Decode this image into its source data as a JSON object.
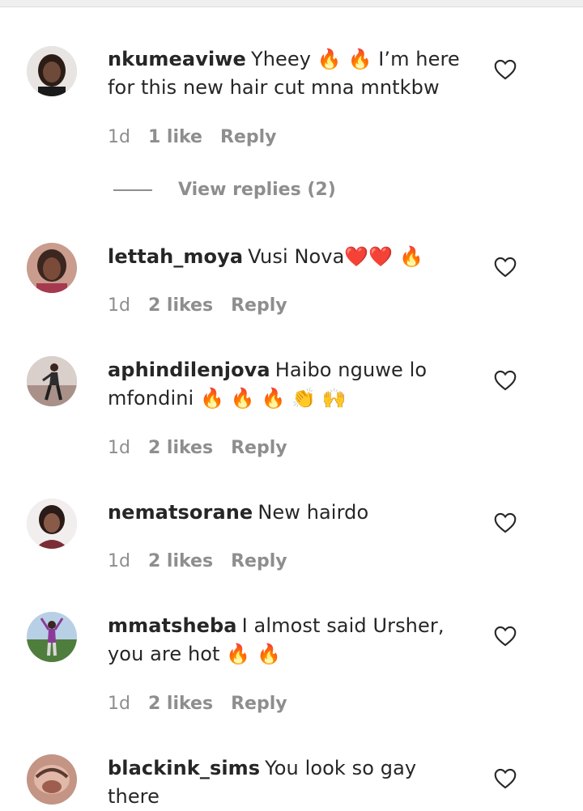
{
  "comments": [
    {
      "username": "nkumeaviwe",
      "text": "Yheey 🔥 🔥 I’m here for this new hair cut mna mntkbw",
      "time": "1d",
      "likes": "1 like",
      "reply": "Reply",
      "avatar_color": "#3a2a22"
    },
    {
      "username": "lettah_moya",
      "text": "Vusi Nova❤️❤️ 🔥",
      "time": "1d",
      "likes": "2 likes",
      "reply": "Reply",
      "avatar_color": "#b98d7c"
    },
    {
      "username": "aphindilenjova",
      "text": "Haibo nguwe lo mfondini 🔥 🔥 🔥 👏 🙌",
      "time": "1d",
      "likes": "2 likes",
      "reply": "Reply",
      "avatar_color": "#b9a9a4"
    },
    {
      "username": "nematsorane",
      "text": "New hairdo",
      "time": "1d",
      "likes": "2 likes",
      "reply": "Reply",
      "avatar_color": "#7a3b3b"
    },
    {
      "username": "mmatsheba",
      "text": "I almost said Ursher, you are hot 🔥 🔥",
      "time": "1d",
      "likes": "2 likes",
      "reply": "Reply",
      "avatar_color": "#6e8f5c"
    },
    {
      "username": "blackink_sims",
      "text": "You look so gay there",
      "avatar_color": "#b57b6a"
    }
  ],
  "view_replies": "View replies (2)",
  "icons": {
    "heart": "heart-outline-icon"
  }
}
